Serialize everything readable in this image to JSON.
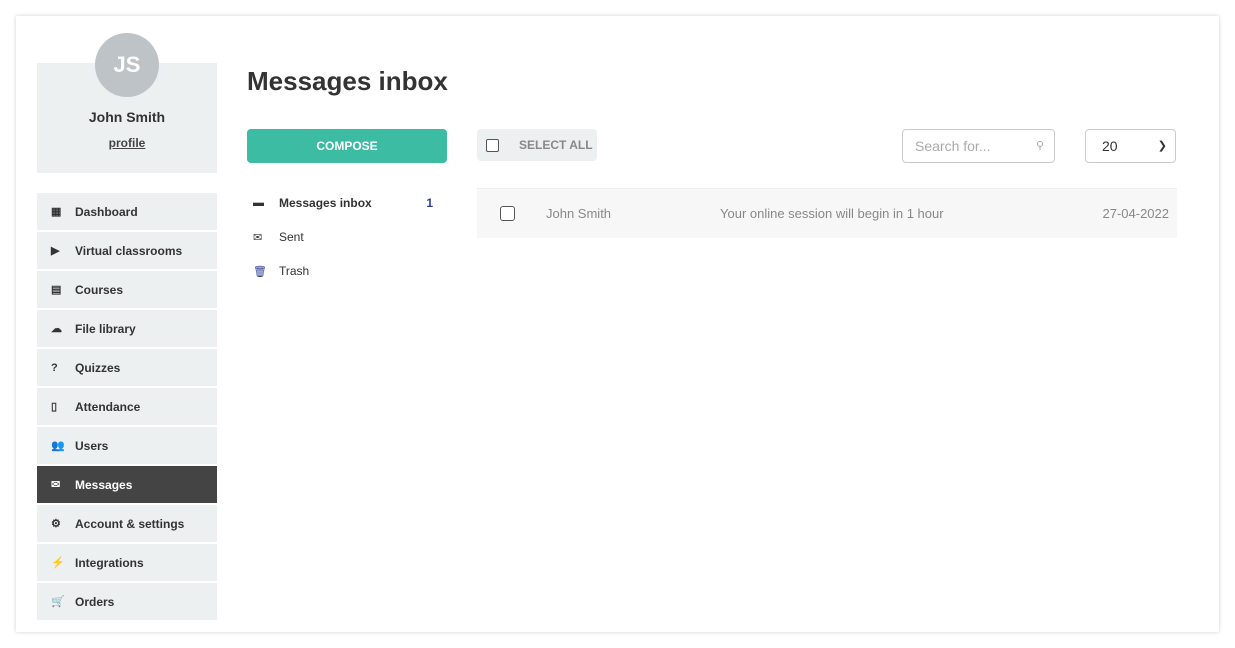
{
  "user": {
    "initials": "JS",
    "name": "John Smith",
    "profile_link": "profile"
  },
  "sidebar": {
    "items": [
      {
        "label": "Dashboard",
        "icon": "dashboard-icon",
        "glyph": "▦"
      },
      {
        "label": "Virtual classrooms",
        "icon": "play-circle-icon",
        "glyph": "▶"
      },
      {
        "label": "Courses",
        "icon": "book-icon",
        "glyph": "▤"
      },
      {
        "label": "File library",
        "icon": "cloud-upload-icon",
        "glyph": "☁"
      },
      {
        "label": "Quizzes",
        "icon": "question-circle-icon",
        "glyph": "?"
      },
      {
        "label": "Attendance",
        "icon": "file-text-icon",
        "glyph": "▯"
      },
      {
        "label": "Users",
        "icon": "users-icon",
        "glyph": "👥"
      },
      {
        "label": "Messages",
        "icon": "envelope-icon",
        "glyph": "✉",
        "active": true
      },
      {
        "label": "Account & settings",
        "icon": "gear-icon",
        "glyph": "⚙"
      },
      {
        "label": "Integrations",
        "icon": "plug-icon",
        "glyph": "⚡"
      },
      {
        "label": "Orders",
        "icon": "cart-icon",
        "glyph": "🛒"
      }
    ]
  },
  "main": {
    "title": "Messages inbox",
    "compose_label": "COMPOSE",
    "select_all_label": "SELECT ALL",
    "search": {
      "placeholder": "Search for..."
    },
    "per_page": "20",
    "folders": [
      {
        "label": "Messages inbox",
        "count": "1",
        "glyph": "▬"
      },
      {
        "label": "Sent",
        "glyph": "✉"
      },
      {
        "label": "Trash",
        "glyph": "🗑"
      }
    ],
    "messages": [
      {
        "from": "John Smith",
        "subject": "Your online session will begin in 1 hour",
        "date": "27-04-2022"
      }
    ]
  },
  "colors": {
    "accent": "#3cbca2",
    "active_nav": "#444444",
    "nav_bg": "#ecf0f1"
  }
}
